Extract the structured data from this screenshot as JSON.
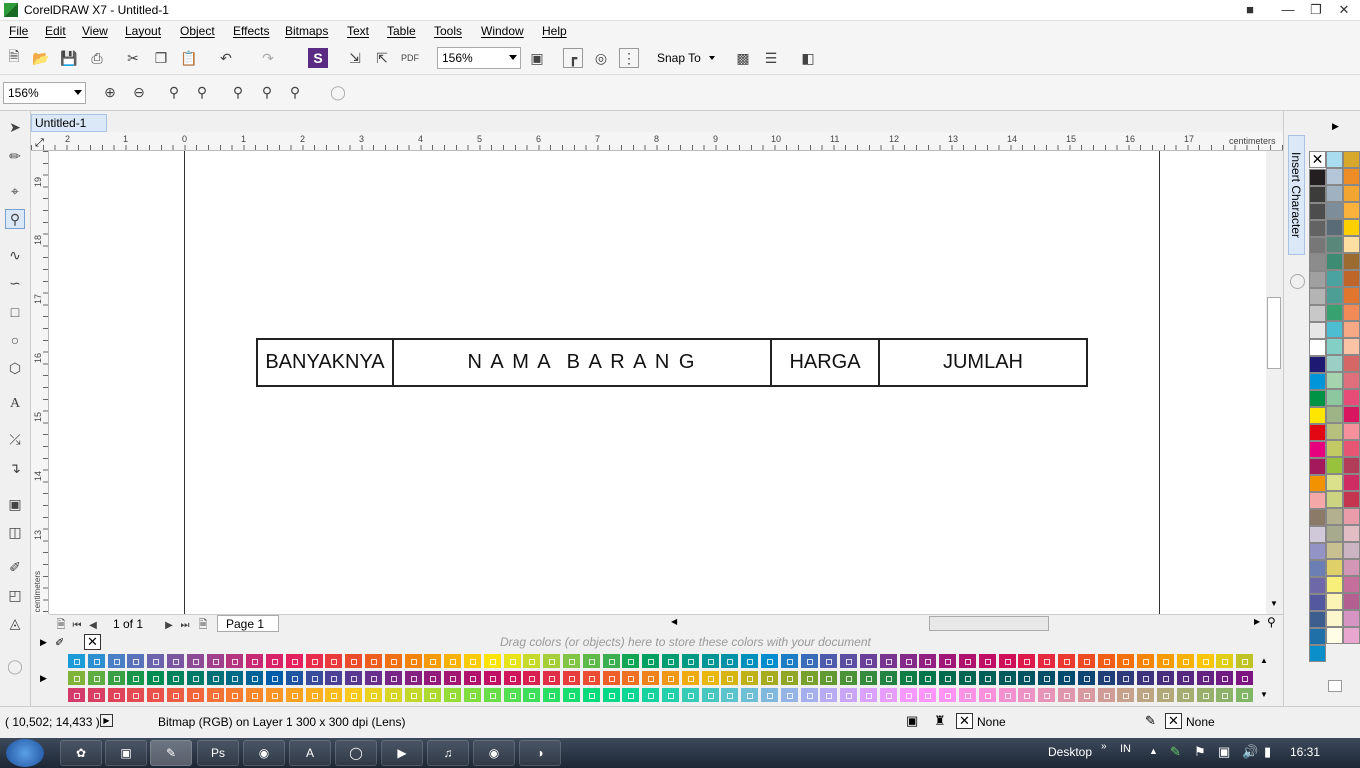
{
  "titlebar": {
    "title": "CorelDRAW X7 - Untitled-1"
  },
  "menu": [
    "File",
    "Edit",
    "View",
    "Layout",
    "Object",
    "Effects",
    "Bitmaps",
    "Text",
    "Table",
    "Tools",
    "Window",
    "Help"
  ],
  "toolbar": {
    "zoom_level": "156%",
    "snap_to": "Snap To"
  },
  "property_bar": {
    "zoom_level": "156%"
  },
  "document_tab": "Untitled-1",
  "ruler": {
    "unit": "centimeters",
    "h_labels": [
      "2",
      "1",
      "0",
      "1",
      "2",
      "3",
      "4",
      "5",
      "6",
      "7",
      "8",
      "9",
      "10",
      "11",
      "12",
      "13",
      "14",
      "15",
      "16",
      "17"
    ],
    "v_labels": [
      "19",
      "18",
      "17",
      "16",
      "15",
      "14",
      "13"
    ]
  },
  "table_header": {
    "cells": [
      "BANYAKNYA",
      "N A M A  B A R A N G",
      "HARGA",
      "JUMLAH"
    ]
  },
  "page_nav": {
    "page_count": "1 of 1",
    "page_tab": "Page 1"
  },
  "docker": {
    "label": "Insert Character"
  },
  "palette": {
    "drag_hint": "Drag colors (or objects) here to store these colors with your document",
    "right_col1": [
      "#231f20",
      "#3c3c3b",
      "#4d4d4d",
      "#636363",
      "#777",
      "#8c8c8c",
      "#a0a0a0",
      "#b4b4b4",
      "#c8c8c8",
      "#e6e6e6",
      "#fff",
      "#1e1a74",
      "#0095d9",
      "#009245",
      "#ffe600",
      "#e30613",
      "#e6007e",
      "#a3195b",
      "#f39200",
      "#f5a8a8",
      "#8a7a67",
      "#cfc9d9",
      "#9393c6",
      "#6b7fb4",
      "#6e67a8",
      "#54589e",
      "#3e5e8f",
      "#1f6fa8",
      "#0b8fcb"
    ],
    "right_col2": [
      "#aadcef",
      "#b4c6d8",
      "#a0b1c2",
      "#7d8d99",
      "#5a6b78",
      "#59887a",
      "#3e8b74",
      "#4aa3a0",
      "#4d9f95",
      "#37a270",
      "#4dbdd1",
      "#83cfc5",
      "#9bcfc5",
      "#a4d3ae",
      "#8cc7a0",
      "#9fb486",
      "#b8c07e",
      "#c1ca63",
      "#99c23c",
      "#dbe08a",
      "#cbd480",
      "#b3b090",
      "#a7aa8d",
      "#c8c090",
      "#e0d06a",
      "#f8ee7a",
      "#fbf4b4",
      "#fcf7cc",
      "#fffde6"
    ],
    "right_col3": [
      "#d7a82b",
      "#ee8d25",
      "#f3a532",
      "#fab23c",
      "#fcd000",
      "#fddfa2",
      "#9c6b2f",
      "#c0652a",
      "#e1752d",
      "#f28a57",
      "#f6a984",
      "#fbc3a6",
      "#d56766",
      "#df6f7d",
      "#e64c77",
      "#d8155e",
      "#f6909d",
      "#e65674",
      "#b23c5a",
      "#ce2c62",
      "#c4364f",
      "#ea9cab",
      "#e2bdc3",
      "#cbb5c2",
      "#d197b4",
      "#c46f9b",
      "#b35f8f",
      "#d694c3",
      "#e9a6cf"
    ],
    "bottom_row1": [
      "#1b9bd7",
      "#2d8fd0",
      "#4a7fc6",
      "#5a72b9",
      "#6b64ad",
      "#7a56a1",
      "#8d4a95",
      "#a03f8a",
      "#b5347e",
      "#c72a72",
      "#d82368",
      "#e61f5e",
      "#e82c4c",
      "#e93b3b",
      "#ea4c2c",
      "#ec5d1f",
      "#ef7014",
      "#f2840d",
      "#f59a09",
      "#f8b206",
      "#fbcb05",
      "#fde406",
      "#e6e31b",
      "#c6da2b",
      "#a4cf39",
      "#82c443",
      "#5fb84a",
      "#3aae50",
      "#13a556",
      "#00a063",
      "#009c72",
      "#009983",
      "#009695",
      "#0093a8",
      "#0090bb",
      "#008dce",
      "#1c7cc4",
      "#3b6cb8",
      "#4f5cab",
      "#5c4ea1",
      "#6a4198",
      "#773590",
      "#842a88",
      "#922080",
      "#a01877",
      "#af126d",
      "#bf0e63",
      "#cf0e58",
      "#de1a4c",
      "#e52a3f",
      "#ea3a30",
      "#ee4b22",
      "#f05d15",
      "#f3700b",
      "#f58505",
      "#f79b03",
      "#f9b104",
      "#fbc607",
      "#e0cd16",
      "#c0c325"
    ],
    "bottom_row2": [
      "#7fb438",
      "#5eab3f",
      "#3aa045",
      "#18964b",
      "#008c52",
      "#00835c",
      "#007a68",
      "#007277",
      "#006a87",
      "#006398",
      "#005daa",
      "#1f54a3",
      "#3a4b9c",
      "#4b4196",
      "#5a3891",
      "#692f8c",
      "#772686",
      "#851f80",
      "#93197a",
      "#a11573",
      "#b0126b",
      "#c01063",
      "#cf165a",
      "#d92151",
      "#e12e47",
      "#e73d3d",
      "#ea4d33",
      "#ec5e2a",
      "#ee7022",
      "#ef831b",
      "#f09716",
      "#f1ab12",
      "#eab70f",
      "#d6b512",
      "#bfb118",
      "#a7ac1f",
      "#8fa626",
      "#78a02d",
      "#629933",
      "#4c9239",
      "#378b3e",
      "#238342",
      "#107c46",
      "#00744a",
      "#006c4d",
      "#006551",
      "#005f56",
      "#005a5b",
      "#005461",
      "#004f67",
      "#004a6d",
      "#0f4572",
      "#203f76",
      "#2f3a79",
      "#3d347c",
      "#4a2e7e",
      "#572880",
      "#642281",
      "#711c82",
      "#7e1682"
    ],
    "bottom_row3": [
      "#d23b6b",
      "#d83e62",
      "#de435a",
      "#e34a52",
      "#e8524a",
      "#ec5b43",
      "#f0653c",
      "#f37036",
      "#f67b30",
      "#f8872b",
      "#f99426",
      "#faa122",
      "#fbae1f",
      "#fbbb1d",
      "#fbc81c",
      "#ead01f",
      "#d6d424",
      "#c1d72a",
      "#acda31",
      "#96dc38",
      "#80dd40",
      "#6ade48",
      "#54de51",
      "#3ede5b",
      "#29dd65",
      "#17dc70",
      "#0ada7b",
      "#06d887",
      "#0ad593",
      "#15d29f",
      "#24cfab",
      "#35cbb6",
      "#48c7c1",
      "#5bc3cb",
      "#6ebed5",
      "#81b9de",
      "#94b4e6",
      "#a6afed",
      "#b8aaf3",
      "#c9a5f8",
      "#d9a0fc",
      "#e89cfe",
      "#f598ff",
      "#fd95fc",
      "#fd93f2",
      "#fb92e7",
      "#f791dc",
      "#f391d0",
      "#ed92c4",
      "#e794b8",
      "#e096ac",
      "#d899a0",
      "#cf9d95",
      "#c6a18b",
      "#bca582",
      "#b1a97a",
      "#a5ad73",
      "#99b06d",
      "#8cb369",
      "#80b666"
    ],
    "none_label_fill": "None",
    "none_label_outline": "None"
  },
  "statusbar": {
    "coords": "( 10,502; 14,433 )",
    "info": "Bitmap (RGB) on Layer 1 300 x 300 dpi  (Lens)",
    "fill_label": "None",
    "outline_label": "None"
  },
  "taskbar": {
    "desktop_label": "Desktop",
    "lang": "IN",
    "clock": "16:31",
    "apps": [
      "corel-app",
      "ps-app",
      "firefox-app",
      "a-app",
      "chat-app",
      "media-app",
      "audio-app",
      "owl-app",
      "paint-app"
    ]
  },
  "colors": {
    "accent": "#dbe8f7",
    "page_border": "#222222",
    "canvas": "#ffffff"
  }
}
